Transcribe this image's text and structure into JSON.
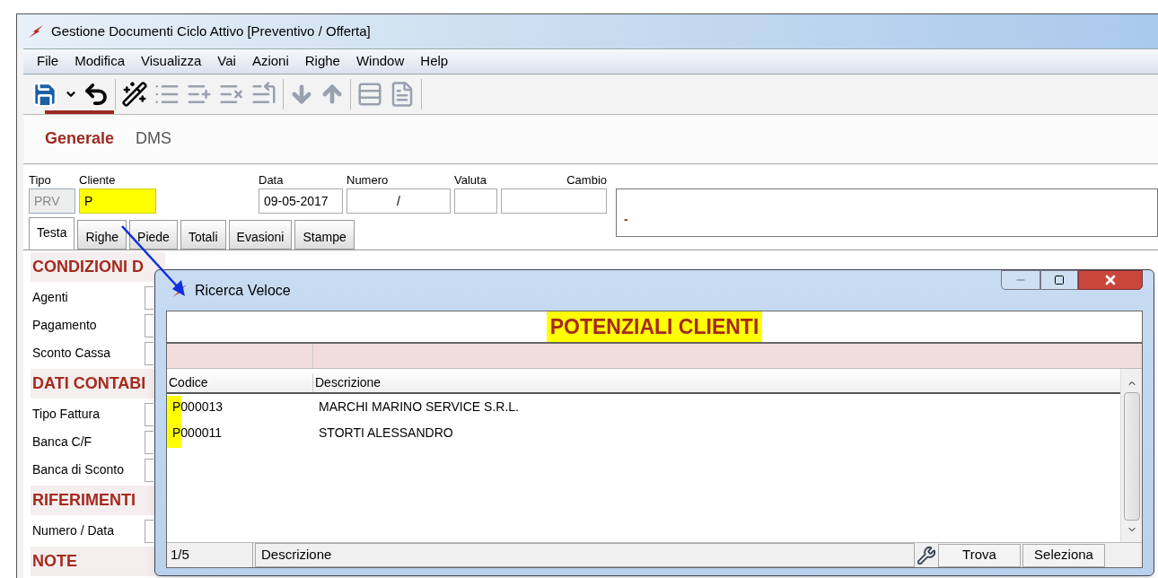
{
  "window": {
    "title": "Gestione Documenti Ciclo Attivo [Preventivo / Offerta]"
  },
  "menu": [
    "File",
    "Modifica",
    "Visualizza",
    "Vai",
    "Azioni",
    "Righe",
    "Window",
    "Help"
  ],
  "page_tabs": [
    {
      "label": "Generale",
      "selected": true
    },
    {
      "label": "DMS",
      "selected": false
    }
  ],
  "header_fields": [
    {
      "label": "Tipo",
      "value": "PRV",
      "disabled": true,
      "highlighted": false
    },
    {
      "label": "Cliente",
      "value": "P",
      "disabled": false,
      "highlighted": true
    },
    {
      "label": "Data",
      "value": "09-05-2017",
      "disabled": false,
      "highlighted": false
    },
    {
      "label": "Numero",
      "value": "/",
      "disabled": false,
      "highlighted": false
    },
    {
      "label": "Valuta",
      "disabled": false,
      "highlighted": false
    },
    {
      "label": "Cambio",
      "disabled": false,
      "highlighted": false
    }
  ],
  "description_box": {
    "value": "-"
  },
  "doc_tabs": [
    {
      "label": "Testa",
      "selected": true
    },
    {
      "label": "Righe",
      "selected": false
    },
    {
      "label": "Piede",
      "selected": false
    },
    {
      "label": "Totali",
      "selected": false
    },
    {
      "label": "Evasioni",
      "selected": false
    },
    {
      "label": "Stampe",
      "selected": false
    }
  ],
  "sections": [
    {
      "title": "CONDIZIONI D",
      "fields": [
        "Agenti",
        "Pagamento",
        "Sconto Cassa"
      ]
    },
    {
      "title": "DATI CONTABI",
      "fields": [
        "Tipo Fattura",
        "Banca C/F",
        "Banca di Sconto"
      ]
    },
    {
      "title": "RIFERIMENTI",
      "fields": [
        "Numero / Data"
      ]
    },
    {
      "title": "NOTE"
    }
  ],
  "dialog": {
    "title": "Ricerca Veloce",
    "heading": "POTENZIALI CLIENTI",
    "heading_highlighted": true,
    "columns": [
      "Codice",
      "Descrizione"
    ],
    "rows": [
      {
        "codice": "P000013",
        "descrizione": "MARCHI MARINO SERVICE S.R.L."
      },
      {
        "codice": "P000011",
        "descrizione": "STORTI ALESSANDRO"
      }
    ],
    "status": {
      "count": "1/5",
      "field": "Descrizione"
    },
    "buttons": [
      "Trova",
      "Seleziona"
    ]
  }
}
